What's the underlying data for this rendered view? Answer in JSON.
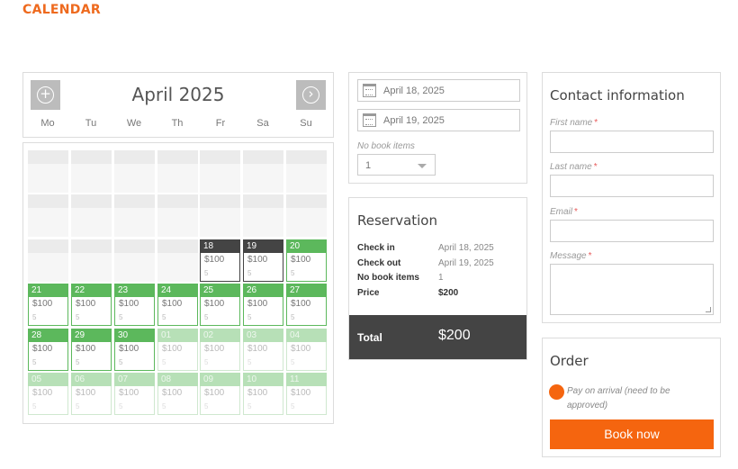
{
  "page": {
    "title": "CALENDAR"
  },
  "calendar": {
    "month_title": "April 2025",
    "prev_icon": "plus-circle-icon",
    "next_icon": "chevron-right-circle-icon",
    "weekdays": [
      "Mo",
      "Tu",
      "We",
      "Th",
      "Fr",
      "Sa",
      "Su"
    ],
    "colors": {
      "selected": "#444444",
      "available": "#5cb85c",
      "faded": "#b7e0b7"
    },
    "days": [
      {
        "day": "18",
        "price": "$100",
        "avail": "5",
        "state": "selected"
      },
      {
        "day": "19",
        "price": "$100",
        "avail": "5",
        "state": "selected"
      },
      {
        "day": "20",
        "price": "$100",
        "avail": "5",
        "state": "available"
      },
      {
        "day": "21",
        "price": "$100",
        "avail": "5",
        "state": "available"
      },
      {
        "day": "22",
        "price": "$100",
        "avail": "5",
        "state": "available"
      },
      {
        "day": "23",
        "price": "$100",
        "avail": "5",
        "state": "available"
      },
      {
        "day": "24",
        "price": "$100",
        "avail": "5",
        "state": "available"
      },
      {
        "day": "25",
        "price": "$100",
        "avail": "5",
        "state": "available"
      },
      {
        "day": "26",
        "price": "$100",
        "avail": "5",
        "state": "available"
      },
      {
        "day": "27",
        "price": "$100",
        "avail": "5",
        "state": "available"
      },
      {
        "day": "28",
        "price": "$100",
        "avail": "5",
        "state": "available"
      },
      {
        "day": "29",
        "price": "$100",
        "avail": "5",
        "state": "available"
      },
      {
        "day": "30",
        "price": "$100",
        "avail": "5",
        "state": "available"
      },
      {
        "day": "01",
        "price": "$100",
        "avail": "5",
        "state": "faded"
      },
      {
        "day": "02",
        "price": "$100",
        "avail": "5",
        "state": "faded"
      },
      {
        "day": "03",
        "price": "$100",
        "avail": "5",
        "state": "faded"
      },
      {
        "day": "04",
        "price": "$100",
        "avail": "5",
        "state": "faded"
      },
      {
        "day": "05",
        "price": "$100",
        "avail": "5",
        "state": "faded"
      },
      {
        "day": "06",
        "price": "$100",
        "avail": "5",
        "state": "faded"
      },
      {
        "day": "07",
        "price": "$100",
        "avail": "5",
        "state": "faded"
      },
      {
        "day": "08",
        "price": "$100",
        "avail": "5",
        "state": "faded"
      },
      {
        "day": "09",
        "price": "$100",
        "avail": "5",
        "state": "faded"
      },
      {
        "day": "10",
        "price": "$100",
        "avail": "5",
        "state": "faded"
      },
      {
        "day": "11",
        "price": "$100",
        "avail": "5",
        "state": "faded"
      }
    ]
  },
  "booking": {
    "check_in_value": "April 18, 2025",
    "check_out_value": "April 19, 2025",
    "items_label": "No book items",
    "items_value": "1"
  },
  "reservation": {
    "title": "Reservation",
    "rows": [
      {
        "label": "Check in",
        "value": "April 18, 2025"
      },
      {
        "label": "Check out",
        "value": "April 19, 2025"
      },
      {
        "label": "No book items",
        "value": "1"
      },
      {
        "label": "Price",
        "value": "$200"
      }
    ],
    "total_label": "Total",
    "total_value": "$200"
  },
  "contact": {
    "title": "Contact information",
    "fields": {
      "first_name": "First name",
      "last_name": "Last name",
      "email": "Email",
      "message": "Message"
    },
    "required_mark": "*"
  },
  "order": {
    "title": "Order",
    "option_label": "Pay on arrival (need to be approved)",
    "button_label": "Book now",
    "accent": "#f5650f"
  }
}
